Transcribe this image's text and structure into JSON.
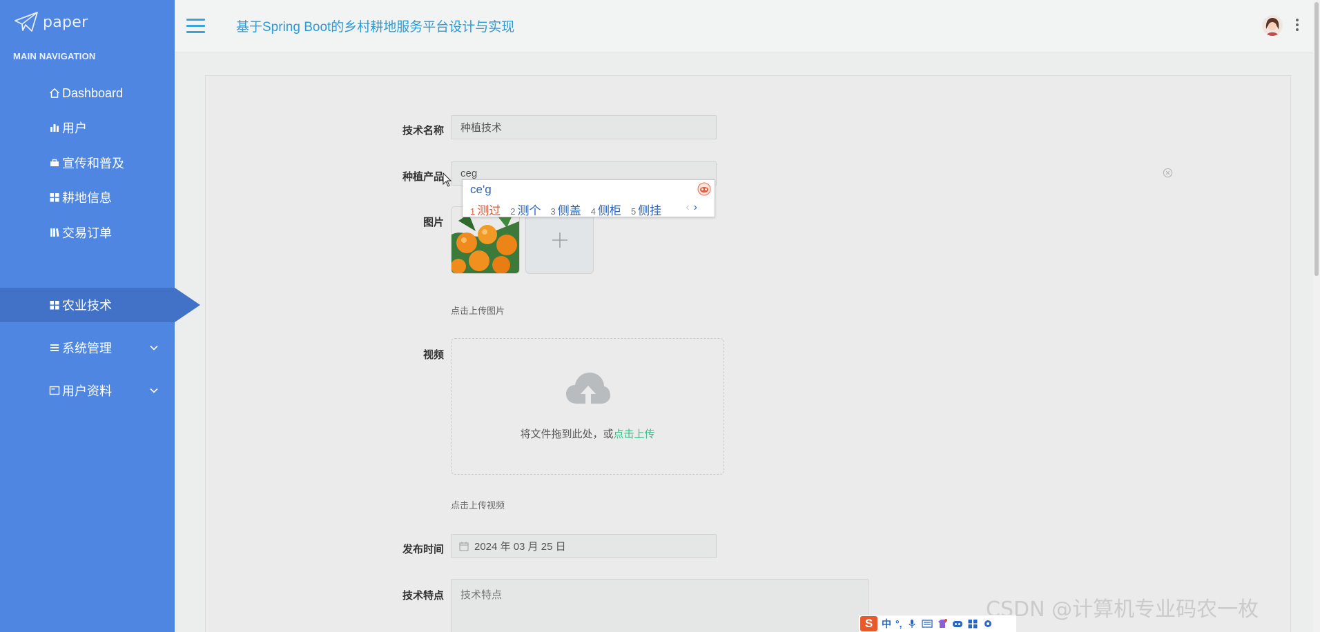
{
  "brand": {
    "name": "paper"
  },
  "sidebar": {
    "header": "MAIN NAVIGATION",
    "items": [
      {
        "label": "Dashboard",
        "icon": "home-icon"
      },
      {
        "label": "用户",
        "icon": "bar-chart-icon"
      },
      {
        "label": "宣传和普及",
        "icon": "briefcase-icon"
      },
      {
        "label": "耕地信息",
        "icon": "grid-icon"
      },
      {
        "label": "交易订单",
        "icon": "book-icon"
      },
      {
        "label": "农业技术",
        "icon": "grid-icon",
        "active": true
      },
      {
        "label": "系统管理",
        "icon": "list-icon",
        "expandable": true
      },
      {
        "label": "用户资料",
        "icon": "card-icon",
        "expandable": true
      }
    ]
  },
  "header": {
    "title": "基于Spring Boot的乡村耕地服务平台设计与实现"
  },
  "form": {
    "tech_name": {
      "label": "技术名称",
      "value": "种植技术"
    },
    "product": {
      "label": "种植产品",
      "value": "ceg"
    },
    "image": {
      "label": "图片",
      "hint": "点击上传图片"
    },
    "video": {
      "label": "视频",
      "drop_text": "将文件拖到此处，或",
      "drop_link": "点击上传",
      "hint": "点击上传视频"
    },
    "publish_time": {
      "label": "发布时间",
      "value": "2024 年 03 月 25 日"
    },
    "features": {
      "label": "技术特点",
      "placeholder": "技术特点"
    }
  },
  "ime": {
    "composition": "ce'g",
    "candidates": [
      {
        "num": "1",
        "text": "测过"
      },
      {
        "num": "2",
        "text": "测个"
      },
      {
        "num": "3",
        "text": "侧盖"
      },
      {
        "num": "4",
        "text": "侧柜"
      },
      {
        "num": "5",
        "text": "侧挂"
      }
    ],
    "prev": "‹",
    "next": "›"
  },
  "ime_toolbar": {
    "logo": "S",
    "mode": "中",
    "punct": "°,"
  },
  "watermark": "CSDN @计算机专业码农一枚",
  "colors": {
    "sidebar": "#4f86e2",
    "sidebar_active": "#4272c8",
    "title": "#2c9ad3",
    "link": "#3cbd8a"
  }
}
